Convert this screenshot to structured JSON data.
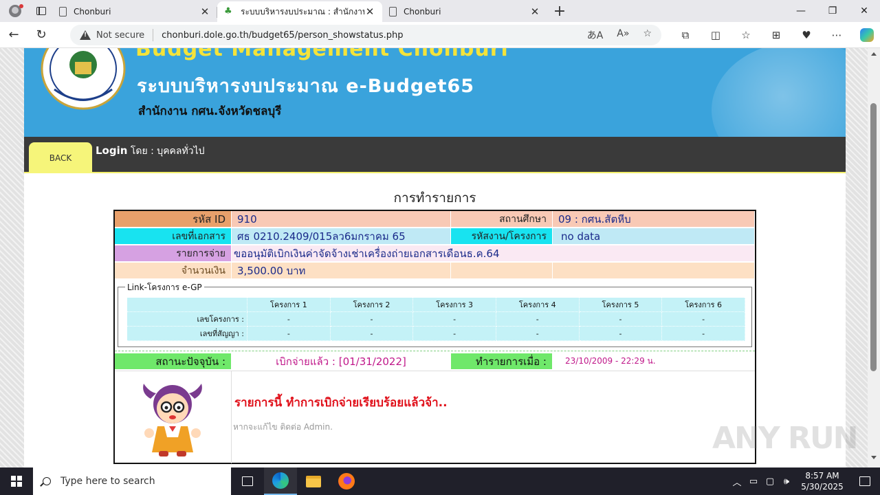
{
  "browser": {
    "tabs": [
      {
        "title": "Chonburi",
        "active": false
      },
      {
        "title": "ระบบบริหารงบประมาณ : สำนักงาน กศน.",
        "active": true
      },
      {
        "title": "Chonburi",
        "active": false
      }
    ],
    "security_label": "Not secure",
    "url": "chonburi.dole.go.th/budget65/person_showstatus.php",
    "icons": [
      "back-arrow-icon",
      "refresh-icon",
      "warning-icon",
      "translate-icon",
      "read-aloud-icon",
      "star-icon",
      "extensions-icon",
      "split-screen-icon",
      "favorites-icon",
      "collections-icon",
      "performance-icon",
      "more-icon",
      "copilot-icon"
    ]
  },
  "banner": {
    "top_text": "Budget Management Chonburi",
    "title": "ระบบบริหารงบประมาณ e-Budget65",
    "subtitle": "สำนักงาน กศน.จังหวัดชลบุรี"
  },
  "nav": {
    "back": "BACK",
    "login_bold": "Login",
    "login_rest": " โดย : บุคคลทั่วไป"
  },
  "page_title": "การทำรายการ",
  "record": {
    "id_label": "รหัส ID",
    "id_value": "910",
    "school_label": "สถานศึกษา",
    "school_value": "09 : กศน.สัตหีบ",
    "doc_label": "เลขที่เอกสาร",
    "doc_value": "ศธ 0210.2409/015ลว6มกราคม 65",
    "project_label": "รหัสงาน/โครงการ",
    "project_value": "no data",
    "item_label": "รายการจ่าย",
    "item_value": "ขออนุมัติเบิกเงินค่าจัดจ้างเช่าเครื่องถ่ายเอกสารเดือนธ.ค.64",
    "amount_label": "จำนวนเงิน",
    "amount_value": "3,500.00  บาท"
  },
  "egp": {
    "legend": "Link-โครงการ e-GP",
    "headers": [
      "โครงการ 1",
      "โครงการ 2",
      "โครงการ 3",
      "โครงการ 4",
      "โครงการ 5",
      "โครงการ 6"
    ],
    "rows": [
      {
        "label": "เลขโครงการ :",
        "values": [
          "-",
          "-",
          "-",
          "-",
          "-",
          "-"
        ]
      },
      {
        "label": "เลขที่สัญญา :",
        "values": [
          "-",
          "-",
          "-",
          "-",
          "-",
          "-"
        ]
      }
    ]
  },
  "status": {
    "label": "สถานะปัจจุบัน :",
    "value": "เบิกจ่ายแล้ว : [01/31/2022]",
    "time_label": "ทำรายการเมื่อ :",
    "time_value": "23/10/2009 - 22:29  น."
  },
  "message": {
    "main": "รายการนี้ ทำการเบิกจ่ายเรียบร้อยแล้วจ้า..",
    "note": "หากจะแก้ไข ติดต่อ Admin."
  },
  "watermark": "ANY RUN",
  "taskbar": {
    "search_placeholder": "Type here to search",
    "time": "8:57 AM",
    "date": "5/30/2025"
  },
  "colors": {
    "banner": "#3aa3dc",
    "navbar": "#3a3a3a",
    "back_button": "#f6f57a",
    "status_text": "#c0188a",
    "message_text": "#e0101a"
  }
}
